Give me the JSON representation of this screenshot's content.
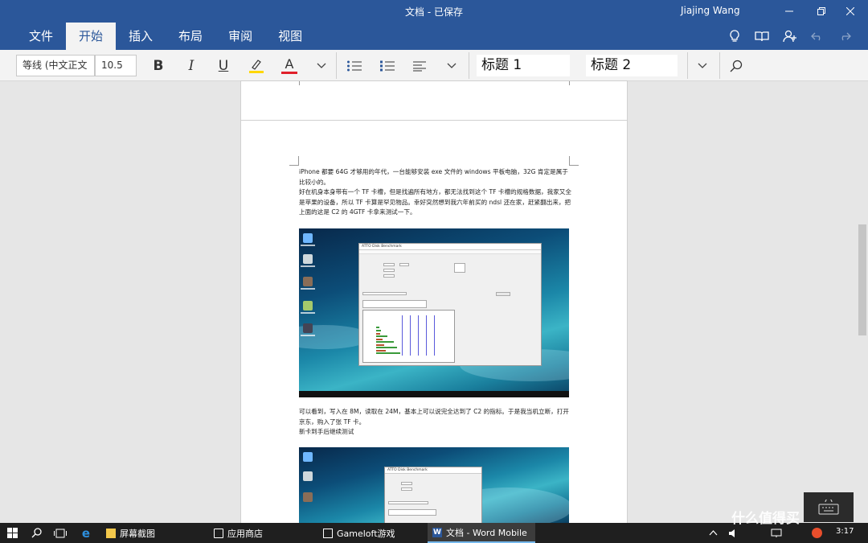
{
  "window": {
    "title": "文档 - 已保存",
    "user": "Jiajing Wang"
  },
  "tabs": [
    {
      "label": "文件"
    },
    {
      "label": "开始"
    },
    {
      "label": "插入"
    },
    {
      "label": "布局"
    },
    {
      "label": "审阅"
    },
    {
      "label": "视图"
    }
  ],
  "ribbon": {
    "font_family": "等线 (中文正文",
    "font_size": "10.5",
    "bold": "B",
    "italic": "I",
    "underline": "U",
    "font_color_glyph": "A",
    "heading1": "标题 1",
    "heading2": "标题 2"
  },
  "colors": {
    "brand": "#2b579a",
    "highlight": "#ffd700",
    "font_color": "#e0202a",
    "active_tab_bg": "#f3f3f3"
  },
  "document": {
    "paragraphs_1": [
      "iPhone 都要 64G 才够用的年代，一台能够安装 exe 文件的 windows 平板电脑，32G 肯定是属于比较小的。",
      "好在机身本身带有一个 TF 卡槽，但是找遍所有地方，都无法找到这个 TF 卡槽的规格数据，我家又全是苹果的设备，所以 TF 卡算是罕见物品。幸好突然想到我六年前买的 ndsl 还在家，赶紧翻出来，把上面的这是 C2 的 4GTF 卡拿来测试一下。"
    ],
    "paragraphs_2": [
      "可以看到，写入在 8M，读取在 24M，基本上可以说完全达到了 C2 的指标。于是我当机立断，打开京东，购入了张 TF 卡。",
      "新卡到手后继续测试"
    ],
    "screenshot_window_title": "ATTO Disk Benchmark"
  },
  "taskbar": {
    "apps": [
      {
        "label": "屏幕截图",
        "icon": "folder-icon"
      },
      {
        "label": "应用商店",
        "icon": "store-icon"
      },
      {
        "label": "Gameloft游戏",
        "icon": "gameloft-icon"
      },
      {
        "label": "文档 - Word Mobile",
        "icon": "word-icon"
      }
    ],
    "time": "3:17"
  },
  "watermark": "什么值得买"
}
